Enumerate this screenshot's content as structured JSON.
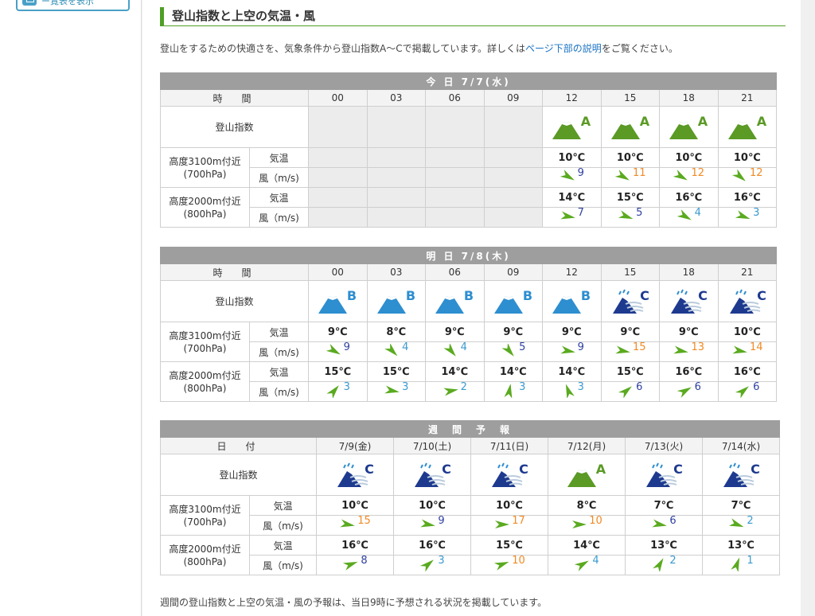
{
  "sidebar": {
    "button_label": "ー覧表を表示"
  },
  "section_title": "登山指数と上空の気温・風",
  "intro": {
    "before": "登山をするための快適さを、気象条件から登山指数A〜Cで掲載しています。詳しくは",
    "link": "ページ下部の説明",
    "after": "をご覧ください。"
  },
  "labels": {
    "time": "時　間",
    "date": "日　付",
    "index": "登山指数",
    "alt3100": "高度3100m付近",
    "hpa700": "(700hPa)",
    "alt2000": "高度2000m付近",
    "hpa800": "(800hPa)",
    "temp": "気温",
    "wind": "風（m/s)"
  },
  "colors": {
    "green_a": "#5a9a25",
    "blue_b": "#2d8ed0",
    "navy_c": "#1e3a8f",
    "speed_low": "#2f40a0",
    "speed_mid": "#3a9ad0",
    "speed_high": "#f08a24",
    "arrow": "#5aaa1f"
  },
  "day1": {
    "title": "今 日 7/7(水)",
    "hours": [
      "00",
      "03",
      "06",
      "09",
      "12",
      "15",
      "18",
      "21"
    ],
    "index": [
      null,
      null,
      null,
      null,
      "A",
      "A",
      "A",
      "A"
    ],
    "temp700": [
      null,
      null,
      null,
      null,
      "10℃",
      "10℃",
      "10℃",
      "10℃"
    ],
    "wind700": [
      null,
      null,
      null,
      null,
      {
        "s": "9",
        "d": 30,
        "c": "low"
      },
      {
        "s": "11",
        "d": 30,
        "c": "high"
      },
      {
        "s": "12",
        "d": 30,
        "c": "high"
      },
      {
        "s": "12",
        "d": 40,
        "c": "high"
      }
    ],
    "temp800": [
      null,
      null,
      null,
      null,
      "14℃",
      "15℃",
      "16℃",
      "16℃"
    ],
    "wind800": [
      null,
      null,
      null,
      null,
      {
        "s": "7",
        "d": 10,
        "c": "low"
      },
      {
        "s": "5",
        "d": 20,
        "c": "low"
      },
      {
        "s": "4",
        "d": 30,
        "c": "mid"
      },
      {
        "s": "3",
        "d": 20,
        "c": "mid"
      }
    ]
  },
  "day2": {
    "title": "明 日 7/8(木)",
    "hours": [
      "00",
      "03",
      "06",
      "09",
      "12",
      "15",
      "18",
      "21"
    ],
    "index": [
      "B",
      "B",
      "B",
      "B",
      "B",
      "C",
      "C",
      "C"
    ],
    "temp700": [
      "9℃",
      "8℃",
      "9℃",
      "9℃",
      "9℃",
      "9℃",
      "9℃",
      "10℃"
    ],
    "wind700": [
      {
        "s": "9",
        "d": 30,
        "c": "low"
      },
      {
        "s": "4",
        "d": 45,
        "c": "mid"
      },
      {
        "s": "4",
        "d": 50,
        "c": "mid"
      },
      {
        "s": "5",
        "d": 50,
        "c": "low"
      },
      {
        "s": "9",
        "d": 10,
        "c": "low"
      },
      {
        "s": "15",
        "d": 10,
        "c": "high"
      },
      {
        "s": "13",
        "d": 10,
        "c": "high"
      },
      {
        "s": "14",
        "d": 10,
        "c": "high"
      }
    ],
    "temp800": [
      "15℃",
      "15℃",
      "14℃",
      "14℃",
      "14℃",
      "15℃",
      "16℃",
      "16℃"
    ],
    "wind800": [
      {
        "s": "3",
        "d": -50,
        "c": "mid"
      },
      {
        "s": "3",
        "d": 10,
        "c": "mid"
      },
      {
        "s": "2",
        "d": -10,
        "c": "mid"
      },
      {
        "s": "3",
        "d": -80,
        "c": "mid"
      },
      {
        "s": "3",
        "d": -110,
        "c": "mid"
      },
      {
        "s": "6",
        "d": -40,
        "c": "low"
      },
      {
        "s": "6",
        "d": -30,
        "c": "low"
      },
      {
        "s": "6",
        "d": -40,
        "c": "low"
      }
    ]
  },
  "week": {
    "title": "週　間　予　報",
    "dates": [
      "7/9(金)",
      "7/10(土)",
      "7/11(日)",
      "7/12(月)",
      "7/13(火)",
      "7/14(水)"
    ],
    "index": [
      "C",
      "C",
      "C",
      "A",
      "C",
      "C"
    ],
    "temp700": [
      "10℃",
      "10℃",
      "10℃",
      "8℃",
      "7℃",
      "7℃"
    ],
    "wind700": [
      {
        "s": "15",
        "d": 10,
        "c": "high"
      },
      {
        "s": "9",
        "d": 10,
        "c": "low"
      },
      {
        "s": "17",
        "d": 0,
        "c": "high"
      },
      {
        "s": "10",
        "d": 0,
        "c": "high"
      },
      {
        "s": "6",
        "d": 10,
        "c": "low"
      },
      {
        "s": "2",
        "d": 20,
        "c": "mid"
      }
    ],
    "temp800": [
      "16℃",
      "16℃",
      "15℃",
      "14℃",
      "13℃",
      "13℃"
    ],
    "wind800": [
      {
        "s": "8",
        "d": -20,
        "c": "low"
      },
      {
        "s": "3",
        "d": -40,
        "c": "mid"
      },
      {
        "s": "10",
        "d": -20,
        "c": "high"
      },
      {
        "s": "4",
        "d": -30,
        "c": "mid"
      },
      {
        "s": "2",
        "d": -60,
        "c": "mid"
      },
      {
        "s": "1",
        "d": -70,
        "c": "mid"
      }
    ]
  },
  "footnote": "週間の登山指数と上空の気温・風の予報は、当日9時に予想される状況を掲載しています。"
}
